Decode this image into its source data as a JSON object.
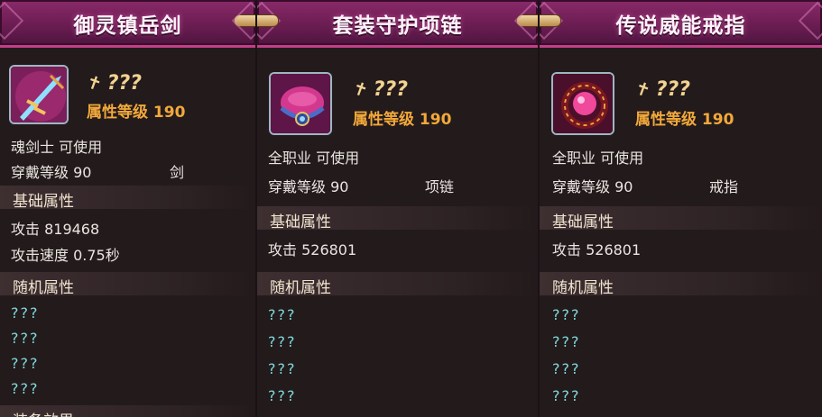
{
  "cards": [
    {
      "title": "御灵镇岳剑",
      "star": "???",
      "level": "属性等级 190",
      "class_use": "魂剑士 可使用",
      "wear_level": "穿戴等级 90",
      "type": "剑",
      "base_section": "基础属性",
      "attack": "攻击 819468",
      "attack_speed": "攻击速度 0.75秒",
      "random_section": "随机属性",
      "random_values": [
        "???",
        "???",
        "???",
        "???"
      ],
      "effect_section": "装备效果"
    },
    {
      "title": "套装守护项链",
      "star": "???",
      "level": "属性等级 190",
      "class_use": "全职业 可使用",
      "wear_level": "穿戴等级 90",
      "type": "项链",
      "base_section": "基础属性",
      "attack": "攻击 526801",
      "random_section": "随机属性",
      "random_values": [
        "???",
        "???",
        "???",
        "???"
      ]
    },
    {
      "title": "传说威能戒指",
      "star": "???",
      "level": "属性等级 190",
      "class_use": "全职业 可使用",
      "wear_level": "穿戴等级 90",
      "type": "戒指",
      "base_section": "基础属性",
      "attack": "攻击 526801",
      "random_section": "随机属性",
      "random_values": [
        "???",
        "???",
        "???",
        "???"
      ]
    }
  ]
}
